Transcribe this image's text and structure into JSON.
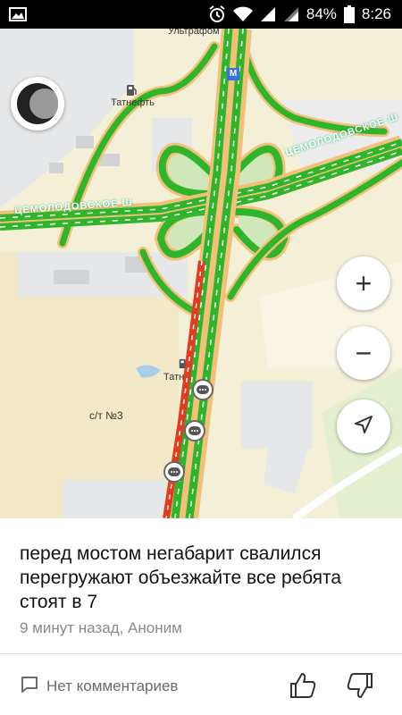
{
  "status_bar": {
    "battery_percent": "84%",
    "time": "8:26",
    "icons": [
      "gallery-icon",
      "alarm-icon",
      "wifi-icon",
      "signal-icon",
      "signal-icon",
      "battery-icon"
    ]
  },
  "map": {
    "labels": {
      "ultra": "Ультрафом",
      "tatneft_top": "Татнефть",
      "tatneft_bottom": "Татн",
      "st3": "с/т №3",
      "road_right": "ЦЕМОЛОДОВСКОЕ Ш",
      "road_left": "ЦЕМОЛОДОВСКОЕ Ш"
    },
    "metro_letter": "M",
    "colors": {
      "road_green": "#2fb52b",
      "road_red": "#e23b1f",
      "road_casing": "#f3c07a",
      "land": "#f4f0d8",
      "built": "#e6e7e8",
      "park": "#cfe7b9"
    },
    "buttons": {
      "zoom_in": "+",
      "zoom_out": "−"
    }
  },
  "event": {
    "message": "перед мостом негабарит свалился перегружают объезжайте все ребята стоят в 7",
    "meta": "9 минут назад, Аноним",
    "comments": "Нет комментариев"
  }
}
